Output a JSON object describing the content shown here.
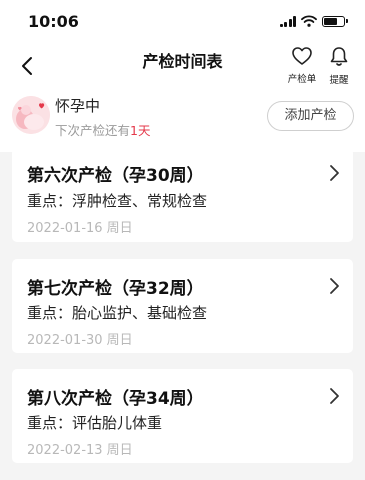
{
  "status_bar": {
    "time": "10:06",
    "icons": [
      "signal-icon",
      "wifi-icon",
      "battery-icon"
    ],
    "battery_level": 0.7
  },
  "header": {
    "title": "产检时间表",
    "actions": [
      {
        "icon": "heart-icon",
        "label": "产检单"
      },
      {
        "icon": "bell-icon",
        "label": "提醒"
      }
    ]
  },
  "user": {
    "stage": "怀孕中",
    "next_prefix": "下次产检还有",
    "days": "1天",
    "add_button": "添加产检"
  },
  "checkups": [
    {
      "title": "第六次产检（孕30周）",
      "focus": "重点：浮肿检查、常规检查",
      "date": "2022-01-16 周日"
    },
    {
      "title": "第七次产检（孕32周）",
      "focus": "重点：胎心监护、基础检查",
      "date": "2022-01-30 周日"
    },
    {
      "title": "第八次产检（孕34周）",
      "focus": "重点：评估胎儿体重",
      "date": "2022-02-13 周日"
    }
  ],
  "colors": {
    "accent": "#e4394b",
    "background": "#f4f4f4",
    "muted_text": "#9a9a9a"
  }
}
